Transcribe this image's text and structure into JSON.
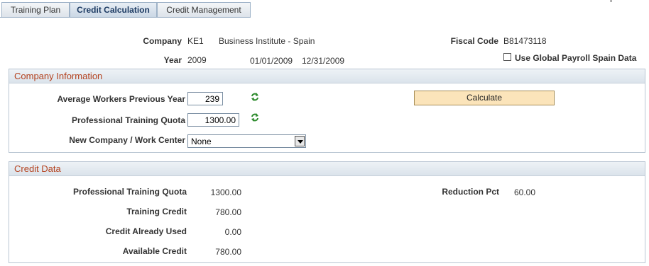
{
  "tabs": [
    {
      "label": "Training Plan",
      "active": false
    },
    {
      "label": "Credit Calculation",
      "active": true
    },
    {
      "label": "Credit Management",
      "active": false
    }
  ],
  "header": {
    "company_label": "Company",
    "company_code": "KE1",
    "company_name": "Business Institute - Spain",
    "fiscal_code_label": "Fiscal Code",
    "fiscal_code": "B81473118",
    "year_label": "Year",
    "year": "2009",
    "start_date": "01/01/2009",
    "end_date": "12/31/2009",
    "global_payroll_label": "Use Global Payroll Spain Data",
    "global_payroll_checked": false
  },
  "company_info": {
    "title": "Company Information",
    "avg_workers_label": "Average Workers Previous Year",
    "avg_workers_value": "239",
    "training_quota_label": "Professional Training Quota",
    "training_quota_value": "1300.00",
    "work_center_label": "New Company / Work Center",
    "work_center_value": "None",
    "calculate_label": "Calculate"
  },
  "credit_data": {
    "title": "Credit Data",
    "training_quota_label": "Professional Training Quota",
    "training_quota_value": "1300.00",
    "training_credit_label": "Training Credit",
    "training_credit_value": "780.00",
    "credit_used_label": "Credit Already Used",
    "credit_used_value": "0.00",
    "available_credit_label": "Available Credit",
    "available_credit_value": "780.00",
    "reduction_pct_label": "Reduction Pct",
    "reduction_pct_value": "60.00"
  },
  "colors": {
    "group_title": "#b4421f",
    "calculate_button": "#fbe4ba",
    "refresh_icon": "#2e8b2e"
  },
  "icons": [
    "refresh-icon",
    "checkbox",
    "dropdown-arrow-icon"
  ]
}
